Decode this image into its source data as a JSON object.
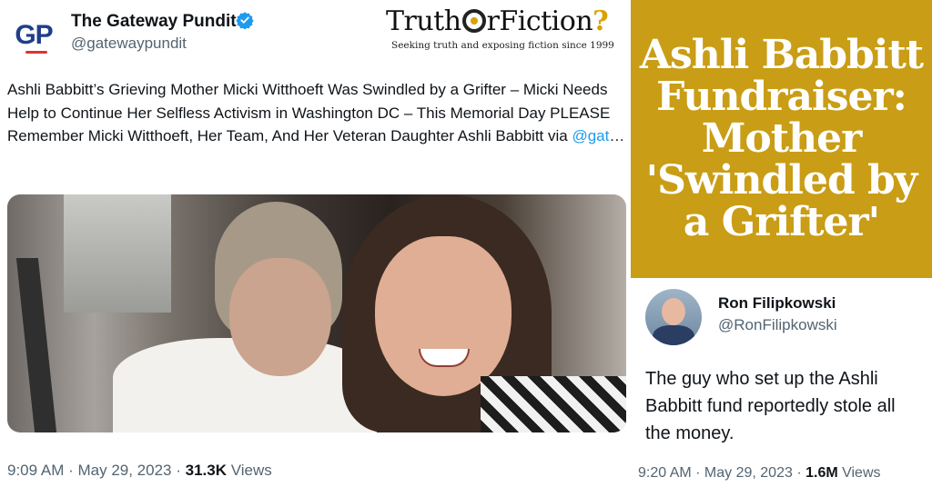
{
  "tweet1": {
    "author_name": "The Gateway Pundit",
    "author_handle": "@gatewaypundit",
    "avatar_text": "GP",
    "text": "Ashli Babbitt’s Grieving Mother Micki Witthoeft Was Swindled by a Grifter – Micki Needs Help to Continue Her Selfless Activism in Washington DC – This Memorial Day PLEASE Remember Micki Witthoeft, Her Team, And Her Veteran Daughter Ashli Babbitt via ",
    "mention": "@gat",
    "ellipsis": "…",
    "time": "9:09 AM · May 29, 2023 · ",
    "views_count": "31.3K",
    "views_label": " Views",
    "verified_icon": "verified-badge-icon",
    "verified_color": "#1d9bf0"
  },
  "brand": {
    "name_part1": "Truth",
    "name_part2": "rFiction",
    "question_mark": "?",
    "tagline": "Seeking truth and exposing fiction since 1999",
    "accent": "#d9a200"
  },
  "headline": {
    "text": "Ashli Babbitt\nFundraiser:\nMother\n'Swindled by\na Grifter'",
    "background": "#c99d15"
  },
  "tweet2": {
    "author_name": "Ron Filipkowski",
    "author_handle": "@RonFilipkowski",
    "text": "The guy who set up the Ashli Babbitt fund reportedly stole all the money.",
    "time": "9:20 AM · May 29, 2023 · ",
    "views_count": "1.6M",
    "views_label": " Views"
  }
}
